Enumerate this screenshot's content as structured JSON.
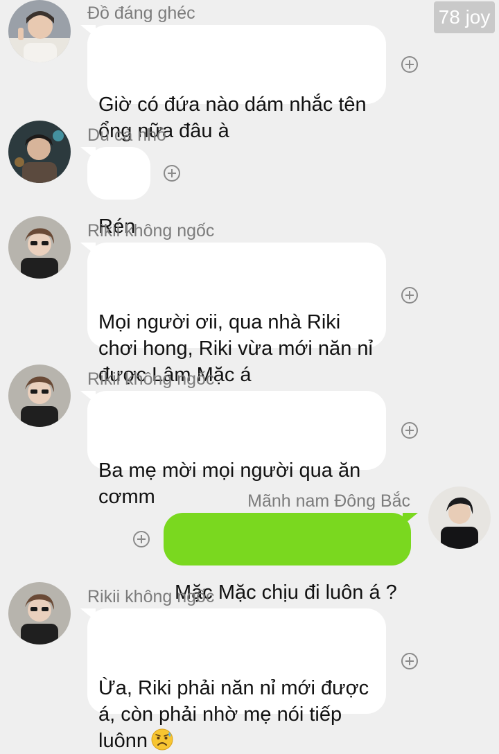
{
  "watermark": "78 joy",
  "messages": [
    {
      "sender": "Đồ đáng ghéc",
      "text": "Giờ có đứa nào dám nhắc tên\nổng nữa đâu à",
      "avatar_icon": "user-avatar-photo",
      "direction": "incoming"
    },
    {
      "sender": "Du cá nhỏ",
      "text": "Rén",
      "avatar_icon": "user-avatar-photo",
      "direction": "incoming"
    },
    {
      "sender": "Rikii không ngốc",
      "text": "Mọi người ơii, qua nhà Riki\nchơi hong, Riki vừa mới năn nỉ\nđược Lâm Mặc á",
      "avatar_icon": "user-avatar-photo",
      "direction": "incoming"
    },
    {
      "sender": "Rikii không ngốc",
      "text": "Ba mẹ mời mọi người qua ăn\ncơmm",
      "avatar_icon": "user-avatar-photo",
      "direction": "incoming"
    },
    {
      "sender": "Mãnh nam Đông Bắc",
      "text": "Mặc Mặc chịu đi luôn á ?",
      "avatar_icon": "user-avatar-photo",
      "direction": "outgoing"
    },
    {
      "sender": "Rikii không ngốc",
      "text": "Ừa, Riki phải năn nỉ mới được\ná, còn phải nhờ mẹ nói tiếp\nluônn",
      "avatar_icon": "user-avatar-photo",
      "direction": "incoming",
      "emoji": "worried-face-emoji"
    }
  ],
  "colors": {
    "background": "#efefef",
    "incoming_bubble": "#ffffff",
    "outgoing_bubble": "#7ad81f",
    "name_text": "#7c7c7c",
    "reaction_icon": "#8a8a8a"
  },
  "icons": {
    "reaction": "add-reaction-icon"
  }
}
